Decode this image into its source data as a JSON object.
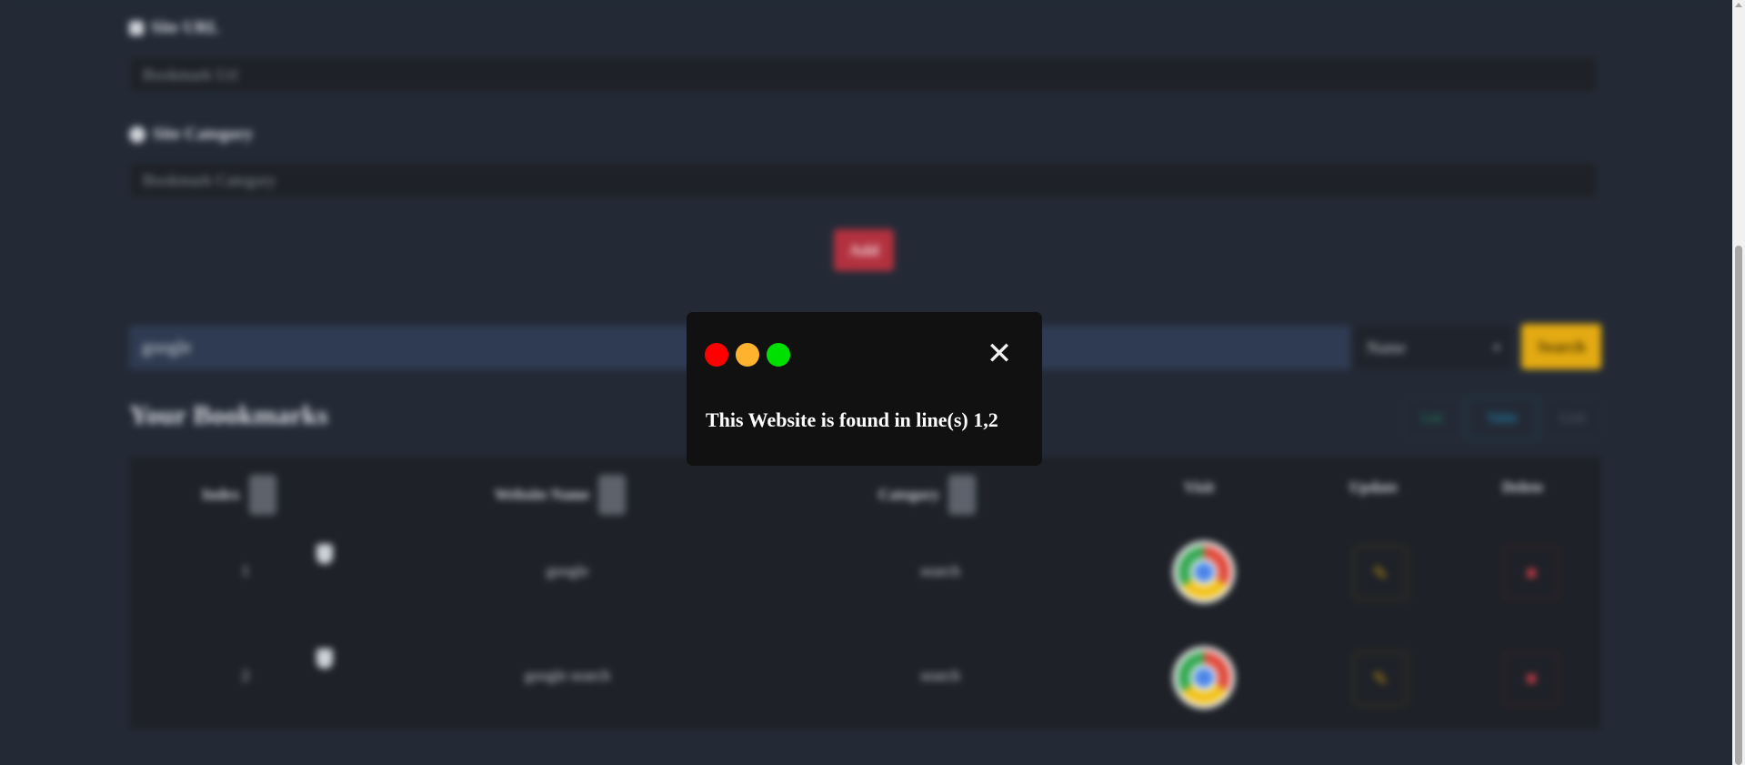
{
  "form": {
    "url_label": "Site URL",
    "url_placeholder": "Bookmark Url",
    "category_label": "Site Category",
    "category_placeholder": "Bookmark Category",
    "add_label": "Add"
  },
  "search": {
    "value": "google",
    "filter_value": "Name",
    "button_label": "Search"
  },
  "bookmarks": {
    "title": "Your Bookmarks",
    "view_toggles": [
      "List",
      "Table",
      "Grid"
    ],
    "columns": {
      "index": "Index",
      "website_name": "Website Name",
      "category": "Category",
      "visit": "Visit",
      "update": "Update",
      "delete": "Delete"
    },
    "rows": [
      {
        "index": "1",
        "name": "google",
        "category": "search"
      },
      {
        "index": "2",
        "name": "google search",
        "category": "search"
      }
    ]
  },
  "modal": {
    "message": "This Website is found in line(s) 1,2",
    "close_glyph": "✕",
    "dot_colors": [
      "#ff0000",
      "#ffb22e",
      "#00e000"
    ]
  },
  "colors": {
    "accent_red": "#b3313f",
    "accent_yellow": "#e3aa12",
    "background": "#232a36",
    "modal_bg": "#111111"
  }
}
